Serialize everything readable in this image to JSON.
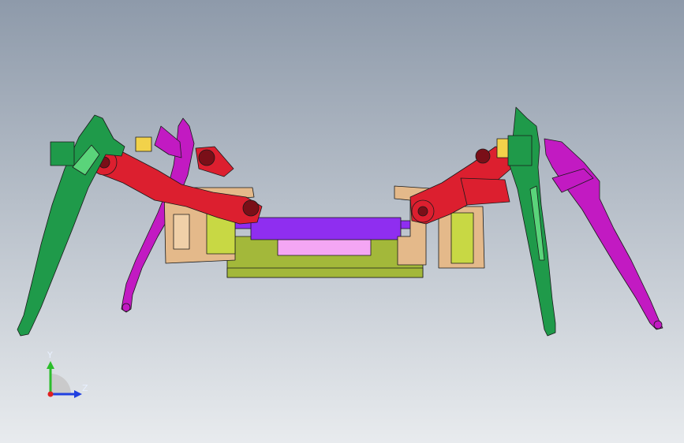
{
  "viewport": {
    "background_top": "#8e9aaa",
    "background_bottom": "#e8ebee"
  },
  "model": {
    "part_colors": {
      "front_leg": "#1f9a4a",
      "rear_leg": "#c21ac2",
      "servo_arm": "#dc1f2f",
      "bracket": "#e4b98a",
      "servo_body": "#c8d844",
      "top_plate": "#8f2ef0",
      "bottom_plate": "#a3b83a",
      "center_block": "#f4a6f4",
      "hinge": "#f2d24a"
    }
  },
  "triad": {
    "y_label": "Y",
    "z_label": "Z",
    "y_color": "#2bbd2b",
    "z_color": "#2040e0",
    "x_color": "#e02020"
  }
}
